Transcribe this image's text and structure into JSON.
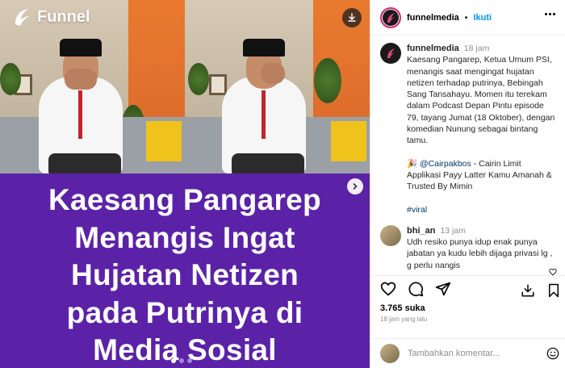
{
  "media": {
    "brand": "Funnel",
    "headline": "Kaesang Pangarep\nMenangis Ingat\nHujatan Netizen\npada Putrinya di\nMedia Sosial",
    "colors": {
      "banner": "#5b22a8"
    },
    "carousel": {
      "dots": 3,
      "active_dot": 0
    }
  },
  "post": {
    "username": "funnelmedia",
    "follow_label": "Ikuti",
    "caption_user": "funnelmedia",
    "caption_time": "18 jam",
    "caption_text": "Kaesang Pangarep, Ketua Umum PSI, menangis saat mengingat hujatan netizen terhadap putrinya, Bebingah Sang Tansahayu. Momen itu terekam dalam Podcast Depan Pintu episode 79, tayang Jumat (18 Oktober), dengan komedian Nunung sebagai bintang tamu.",
    "promo_emoji": "🎉",
    "promo_mention": "@Cairpakbos",
    "promo_text": " - Cairin Limit Applikasi Payy Latter Kamu Amanah & Trusted By Mimin",
    "hashtag": "#viral",
    "comment": {
      "user": "bhi_an",
      "time": "13 jam",
      "text": "Udh resiko punya idup enak punya jabatan ya kudu lebih dijaga privasi lg , g perlu nangis"
    },
    "likes": "3.765 suka",
    "posted_ago": "18 jam yang lalu",
    "comment_placeholder": "Tambahkan komentar..."
  },
  "icons": {
    "like": "heart-icon",
    "comment": "comment-icon",
    "share": "share-icon",
    "save": "bookmark-icon",
    "download": "download-icon",
    "next": "chevron-right-icon",
    "emoji": "emoji-icon"
  },
  "colors": {
    "follow": "#0095f6",
    "muted": "#8e8e8e",
    "ring": "#d62976"
  }
}
